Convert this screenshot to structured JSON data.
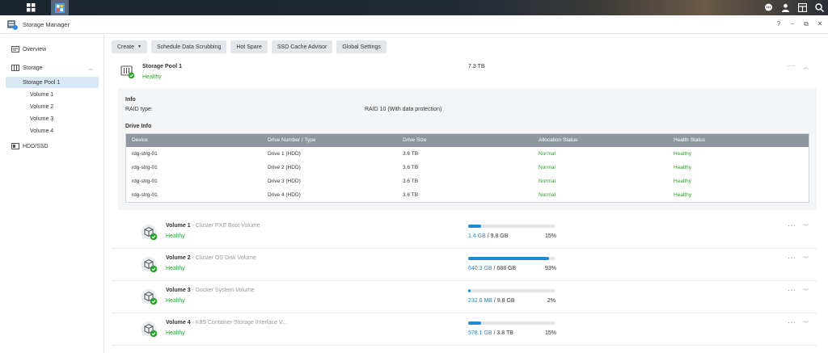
{
  "taskbar": {
    "icons": [
      "grid-icon",
      "storage-manager-app-icon",
      "chat-icon",
      "user-icon",
      "widgets-icon",
      "search-icon"
    ]
  },
  "window": {
    "title": "Storage Manager",
    "controls": [
      "?",
      "–",
      "⧉",
      "✕"
    ]
  },
  "sidebar": {
    "overview": "Overview",
    "storage": "Storage",
    "pool": "Storage Pool 1",
    "volumes": [
      "Volume 1",
      "Volume 2",
      "Volume 3",
      "Volume 4"
    ],
    "hdd": "HDD/SSD"
  },
  "toolbar": {
    "create": "Create",
    "scrub": "Schedule Data Scrubbing",
    "spare": "Hot Spare",
    "advisor": "SSD Cache Advisor",
    "global": "Global Settings"
  },
  "pool": {
    "name": "Storage Pool 1",
    "status": "Healthy",
    "size": "7.3 TB",
    "info_title": "Info",
    "raid_label": "RAID type:",
    "raid_value": "RAID 10 (With data protection)",
    "drive_info_title": "Drive Info",
    "columns": [
      "Device",
      "Drive Number / Type",
      "Drive Size",
      "Allocation Status",
      "Health Status"
    ],
    "drives": [
      [
        "rdg-strg-01",
        "Drive 1 (HDD)",
        "3.6 TB",
        "Normal",
        "Healthy"
      ],
      [
        "rdg-strg-01",
        "Drive 2 (HDD)",
        "3.6 TB",
        "Normal",
        "Healthy"
      ],
      [
        "rdg-strg-01",
        "Drive 3 (HDD)",
        "3.6 TB",
        "Normal",
        "Healthy"
      ],
      [
        "rdg-strg-01",
        "Drive 4 (HDD)",
        "3.6 TB",
        "Normal",
        "Healthy"
      ]
    ]
  },
  "volumes": [
    {
      "name": "Volume 1",
      "desc": " - Cluster PXE Boot Volume",
      "status": "Healthy",
      "used": "1.4 GB",
      "total": " / 9.8 GB",
      "pct": "15%",
      "fill": 0.15
    },
    {
      "name": "Volume 2",
      "desc": " - Cluster OS Disk Volume",
      "status": "Healthy",
      "used": "640.3 GB",
      "total": " / 688 GB",
      "pct": "93%",
      "fill": 0.93
    },
    {
      "name": "Volume 3",
      "desc": " - Docker System Volume",
      "status": "Healthy",
      "used": "232.6 MB",
      "total": " / 9.8 GB",
      "pct": "2%",
      "fill": 0.02
    },
    {
      "name": "Volume 4",
      "desc": " - K8S Container Storage Interface V...",
      "status": "Healthy",
      "used": "578.1 GB",
      "total": " / 3.8 TB",
      "pct": "15%",
      "fill": 0.15
    }
  ],
  "colors": {
    "healthy": "#2aa22a",
    "accent": "#1e88d9",
    "table_header": "#8e979f"
  }
}
